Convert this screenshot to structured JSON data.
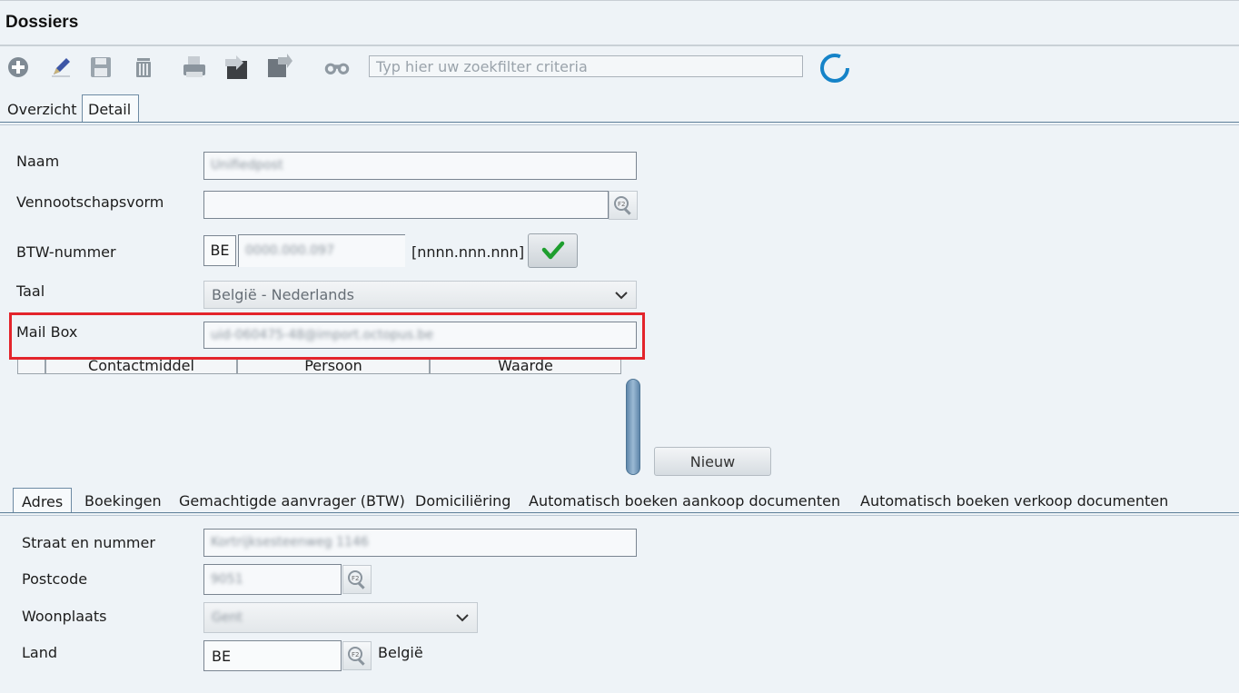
{
  "window": {
    "title": "Dossiers"
  },
  "toolbar": {
    "icons": [
      "add-icon",
      "edit-icon",
      "save-icon",
      "delete-icon",
      "print-icon",
      "export-icon",
      "import-icon",
      "binoculars-icon",
      "loading-icon"
    ],
    "search_placeholder": "Typ hier uw zoekfilter criteria"
  },
  "top_tabs": [
    "Overzicht",
    "Detail"
  ],
  "top_tabs_active": "Detail",
  "form": {
    "naam_label": "Naam",
    "naam_value": "Unifiedpost",
    "vennootschapsvorm_label": "Vennootschapsvorm",
    "vennootschapsvorm_value": "",
    "btw_label": "BTW-nummer",
    "btw_country": "BE",
    "btw_value": "0000.000.097",
    "btw_format": "[nnnn.nnn.nnn]",
    "taal_label": "Taal",
    "taal_value": "België - Nederlands",
    "mailbox_label": "Mail Box",
    "mailbox_value": "uid-060475-48@import.octopus.be"
  },
  "contact_table": {
    "columns": [
      "Contactmiddel",
      "Persoon",
      "Waarde"
    ],
    "new_button": "Nieuw"
  },
  "bottom_tabs": [
    "Adres",
    "Boekingen",
    "Gemachtigde aanvrager (BTW)",
    "Domiciliëring",
    "Automatisch boeken aankoop documenten",
    "Automatisch boeken verkoop documenten"
  ],
  "bottom_tabs_active": "Adres",
  "address": {
    "straat_label": "Straat en nummer",
    "straat_value": "Kortrijksesteenweg 1146",
    "postcode_label": "Postcode",
    "postcode_value": "9051",
    "woonplaats_label": "Woonplaats",
    "woonplaats_value": "Gent",
    "land_label": "Land",
    "land_code": "BE",
    "land_name": "België"
  },
  "colors": {
    "highlight": "#e3242b",
    "accent": "#5c7e98",
    "ok_check": "#1e9e2e"
  }
}
